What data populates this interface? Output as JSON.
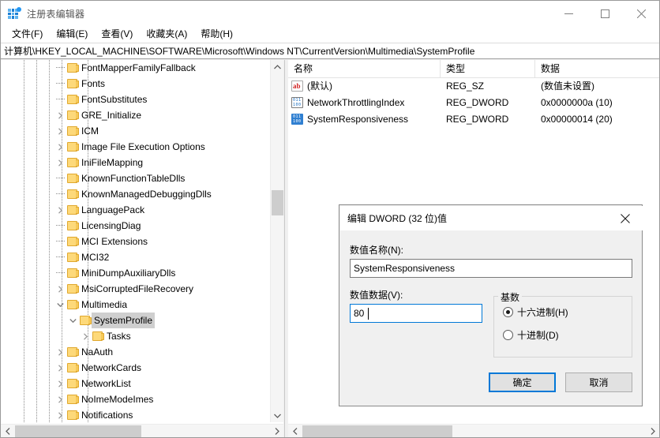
{
  "window": {
    "title": "注册表编辑器",
    "icon": "registry-editor-icon",
    "controls": {
      "minimize": "–",
      "maximize": "□",
      "close": "✕"
    }
  },
  "menu": {
    "items": [
      {
        "label": "文件(F)"
      },
      {
        "label": "编辑(E)"
      },
      {
        "label": "查看(V)"
      },
      {
        "label": "收藏夹(A)"
      },
      {
        "label": "帮助(H)"
      }
    ]
  },
  "address": {
    "path": "计算机\\HKEY_LOCAL_MACHINE\\SOFTWARE\\Microsoft\\Windows NT\\CurrentVersion\\Multimedia\\SystemProfile"
  },
  "tree": {
    "nodes": [
      {
        "label": "FontMapperFamilyFallback",
        "indent": 4,
        "expander": "none",
        "selected": false
      },
      {
        "label": "Fonts",
        "indent": 4,
        "expander": "none",
        "selected": false
      },
      {
        "label": "FontSubstitutes",
        "indent": 4,
        "expander": "none",
        "selected": false
      },
      {
        "label": "GRE_Initialize",
        "indent": 4,
        "expander": "collapsed",
        "selected": false
      },
      {
        "label": "ICM",
        "indent": 4,
        "expander": "collapsed",
        "selected": false
      },
      {
        "label": "Image File Execution Options",
        "indent": 4,
        "expander": "collapsed",
        "selected": false
      },
      {
        "label": "IniFileMapping",
        "indent": 4,
        "expander": "collapsed",
        "selected": false
      },
      {
        "label": "KnownFunctionTableDlls",
        "indent": 4,
        "expander": "none",
        "selected": false
      },
      {
        "label": "KnownManagedDebuggingDlls",
        "indent": 4,
        "expander": "none",
        "selected": false
      },
      {
        "label": "LanguagePack",
        "indent": 4,
        "expander": "collapsed",
        "selected": false
      },
      {
        "label": "LicensingDiag",
        "indent": 4,
        "expander": "none",
        "selected": false
      },
      {
        "label": "MCI Extensions",
        "indent": 4,
        "expander": "none",
        "selected": false
      },
      {
        "label": "MCI32",
        "indent": 4,
        "expander": "none",
        "selected": false
      },
      {
        "label": "MiniDumpAuxiliaryDlls",
        "indent": 4,
        "expander": "none",
        "selected": false
      },
      {
        "label": "MsiCorruptedFileRecovery",
        "indent": 4,
        "expander": "collapsed",
        "selected": false
      },
      {
        "label": "Multimedia",
        "indent": 4,
        "expander": "expanded",
        "selected": false
      },
      {
        "label": "SystemProfile",
        "indent": 5,
        "expander": "expanded",
        "selected": true
      },
      {
        "label": "Tasks",
        "indent": 6,
        "expander": "collapsed",
        "selected": false
      },
      {
        "label": "NaAuth",
        "indent": 4,
        "expander": "collapsed",
        "selected": false
      },
      {
        "label": "NetworkCards",
        "indent": 4,
        "expander": "collapsed",
        "selected": false
      },
      {
        "label": "NetworkList",
        "indent": 4,
        "expander": "collapsed",
        "selected": false
      },
      {
        "label": "NoImeModeImes",
        "indent": 4,
        "expander": "collapsed",
        "selected": false
      },
      {
        "label": "Notifications",
        "indent": 4,
        "expander": "collapsed",
        "selected": false
      }
    ]
  },
  "values": {
    "columns": [
      {
        "label": "名称"
      },
      {
        "label": "类型"
      },
      {
        "label": "数据"
      }
    ],
    "rows": [
      {
        "icon": "string-value-icon",
        "name": "(默认)",
        "type": "REG_SZ",
        "data": "(数值未设置)",
        "selected": false
      },
      {
        "icon": "dword-value-icon",
        "name": "NetworkThrottlingIndex",
        "type": "REG_DWORD",
        "data": "0x0000000a (10)",
        "selected": false
      },
      {
        "icon": "dword-value-icon",
        "name": "SystemResponsiveness",
        "type": "REG_DWORD",
        "data": "0x00000014 (20)",
        "selected": true
      }
    ]
  },
  "dialog": {
    "title": "编辑 DWORD (32 位)值",
    "close_label": "✕",
    "name_label": "数值名称(N):",
    "name_value": "SystemResponsiveness",
    "data_label": "数值数据(V):",
    "data_value": "80",
    "base_group_label": "基数",
    "radios": [
      {
        "label": "十六进制(H)",
        "checked": true
      },
      {
        "label": "十进制(D)",
        "checked": false
      }
    ],
    "ok_label": "确定",
    "cancel_label": "取消"
  },
  "scrollbars": {
    "left_vertical": {
      "up": "⌃",
      "down": "⌄"
    },
    "left_horizontal": {
      "left": "❮",
      "right": "❯"
    },
    "right_horizontal": {
      "left": "❮",
      "right": "❯"
    }
  },
  "colors": {
    "accent": "#0078d7",
    "folder": "#fdd97a",
    "selection": "#cfcfcf",
    "dword_icon": "#2f7fd1"
  }
}
